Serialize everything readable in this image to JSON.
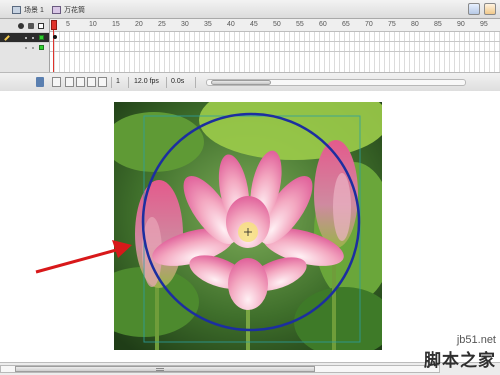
{
  "tabs": {
    "scene_label": "场景 1",
    "symbol_label": "万花筒"
  },
  "timeline": {
    "frame_numbers": [
      "5",
      "10",
      "15",
      "20",
      "25",
      "30",
      "35",
      "40",
      "45",
      "50",
      "55",
      "60",
      "65",
      "70",
      "75",
      "80",
      "85",
      "90",
      "95"
    ],
    "current_frame": "1",
    "fps": "12.0 fps",
    "elapsed": "0.0s"
  },
  "watermark": {
    "domain": "jb51.net",
    "name": "脚本之家"
  },
  "icons": {
    "eye": "eye-icon",
    "lock": "lock-icon",
    "outline": "outline-icon",
    "trash": "trash-icon",
    "pencil": "pencil-icon"
  },
  "colors": {
    "playhead": "#e0322a",
    "circle_stroke": "#1c2ea0",
    "arrow": "#d8181a",
    "layer_selected": "#2b2b2b"
  }
}
